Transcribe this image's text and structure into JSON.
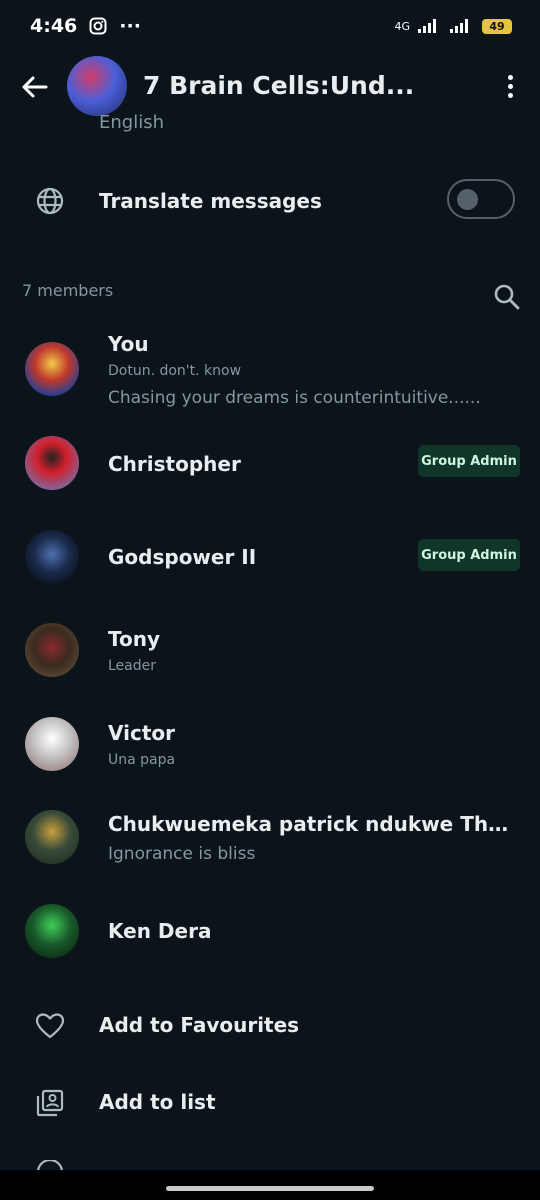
{
  "status_bar": {
    "time": "4:46",
    "dots": "···",
    "network": "4G",
    "battery": "49"
  },
  "header": {
    "title": "7 Brain Cells:Und..."
  },
  "translation": {
    "language": "English",
    "label": "Translate messages",
    "enabled": false
  },
  "members": {
    "count_label": "7 members",
    "list": [
      {
        "name": "You",
        "subtitle": "Dotun. don't. know",
        "about": "Chasing your dreams is counterintuitive......",
        "badge": ""
      },
      {
        "name": "Christopher",
        "subtitle": "",
        "about": "",
        "badge": "Group Admin"
      },
      {
        "name": "Godspower II",
        "subtitle": "",
        "about": "",
        "badge": "Group Admin"
      },
      {
        "name": "Tony",
        "subtitle": "Leader",
        "about": "",
        "badge": ""
      },
      {
        "name": "Victor",
        "subtitle": "Una papa",
        "about": "",
        "badge": ""
      },
      {
        "name": "Chukwuemeka patrick ndukwe The Wa...",
        "subtitle": "",
        "about": "Ignorance is bliss",
        "badge": ""
      },
      {
        "name": "Ken Dera",
        "subtitle": "",
        "about": "",
        "badge": ""
      }
    ]
  },
  "actions": {
    "favourites": "Add to Favourites",
    "list": "Add to list"
  },
  "colors": {
    "background": "#0b141a",
    "badge_bg": "#103529",
    "muted": "#8696a0"
  }
}
